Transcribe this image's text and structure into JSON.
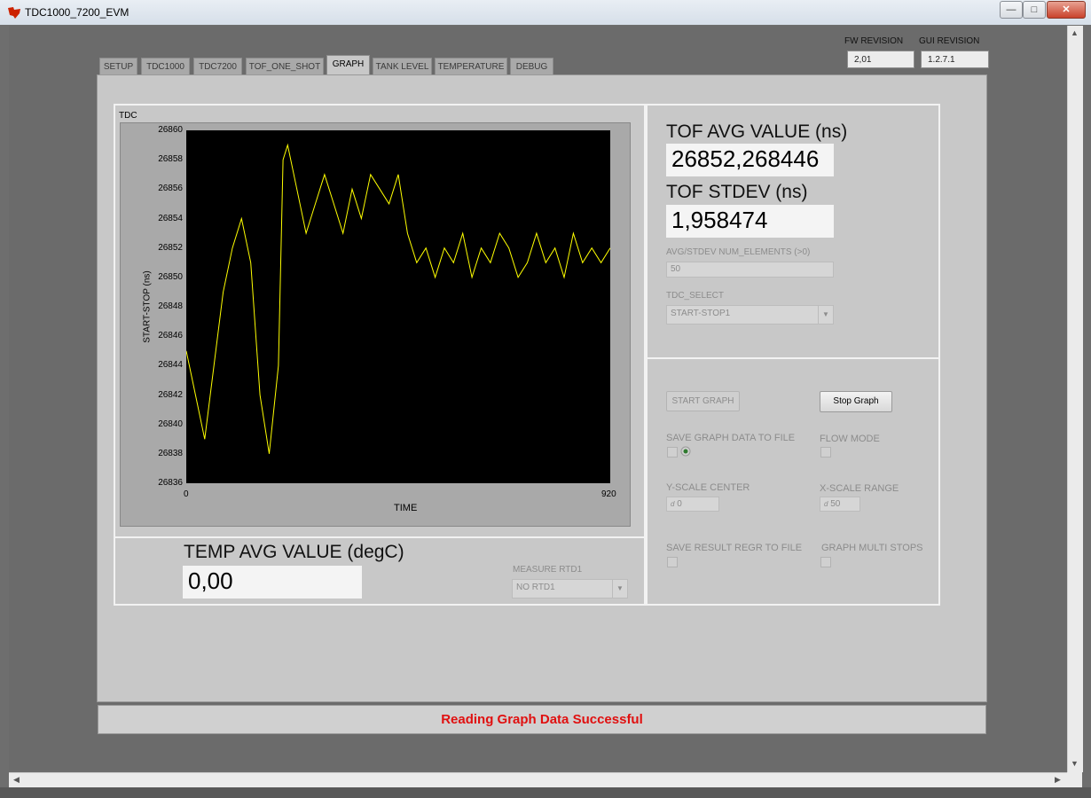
{
  "window": {
    "title": "TDC1000_7200_EVM",
    "minimize": "—",
    "maximize": "□",
    "close": "✕"
  },
  "revisions": {
    "fw_label": "FW REVISION",
    "fw_value": "2,01",
    "gui_label": "GUI REVISION",
    "gui_value": "1.2.7.1"
  },
  "tabs": [
    {
      "label": "SETUP"
    },
    {
      "label": "TDC1000"
    },
    {
      "label": "TDC7200"
    },
    {
      "label": "TOF_ONE_SHOT"
    },
    {
      "label": "GRAPH"
    },
    {
      "label": "TANK LEVEL"
    },
    {
      "label": "TEMPERATURE"
    },
    {
      "label": "DEBUG"
    }
  ],
  "active_tab": "GRAPH",
  "graph": {
    "caption": "TDC"
  },
  "chart_data": {
    "type": "line",
    "title": "TDC",
    "xlabel": "TIME",
    "ylabel": "START-STOP (ns)",
    "xlim": [
      0,
      920
    ],
    "ylim": [
      26836,
      26860
    ],
    "yticks": [
      26860,
      26858,
      26856,
      26854,
      26852,
      26850,
      26848,
      26846,
      26844,
      26842,
      26840,
      26838,
      26836
    ],
    "xticks": [
      0,
      920
    ],
    "grid": false,
    "series": [
      {
        "color": "#ffff00",
        "x": [
          0,
          20,
          40,
          60,
          80,
          100,
          120,
          140,
          160,
          180,
          200,
          210,
          220,
          240,
          260,
          280,
          300,
          320,
          340,
          360,
          380,
          400,
          420,
          440,
          460,
          480,
          500,
          520,
          540,
          560,
          580,
          600,
          620,
          640,
          660,
          680,
          700,
          720,
          740,
          760,
          780,
          800,
          820,
          840,
          860,
          880,
          900,
          920
        ],
        "values": [
          26845,
          26842,
          26839,
          26844,
          26849,
          26852,
          26854,
          26851,
          26842,
          26838,
          26844,
          26858,
          26859,
          26856,
          26853,
          26855,
          26857,
          26855,
          26853,
          26856,
          26854,
          26857,
          26856,
          26855,
          26857,
          26853,
          26851,
          26852,
          26850,
          26852,
          26851,
          26853,
          26850,
          26852,
          26851,
          26853,
          26852,
          26850,
          26851,
          26853,
          26851,
          26852,
          26850,
          26853,
          26851,
          26852,
          26851,
          26852
        ]
      }
    ]
  },
  "tof": {
    "avg_label": "TOF AVG VALUE (ns)",
    "avg_value": "26852,268446",
    "stdev_label": "TOF STDEV (ns)",
    "stdev_value": "1,958474",
    "num_elements_label": "AVG/STDEV NUM_ELEMENTS (>0)",
    "num_elements_value": "50",
    "tdc_select_label": "TDC_SELECT",
    "tdc_select_value": "START-STOP1"
  },
  "temp": {
    "avg_label": "TEMP AVG VALUE (degC)",
    "avg_value": "0,00",
    "rtd_label": "MEASURE RTD1",
    "rtd_value": "NO RTD1"
  },
  "controls": {
    "start_graph": "START GRAPH",
    "stop_graph": "Stop Graph",
    "save_graph_label": "SAVE GRAPH DATA TO FILE",
    "flow_mode_label": "FLOW MODE",
    "y_scale_label": "Y-SCALE CENTER",
    "y_scale_value": "0",
    "y_scale_prefix": "d",
    "x_scale_label": "X-SCALE RANGE",
    "x_scale_value": "50",
    "x_scale_prefix": "d",
    "save_regr_label": "SAVE RESULT REGR TO FILE",
    "multi_stops_label": "GRAPH MULTI STOPS"
  },
  "status": {
    "message": "Reading Graph Data Successful",
    "color": "#e01010"
  }
}
